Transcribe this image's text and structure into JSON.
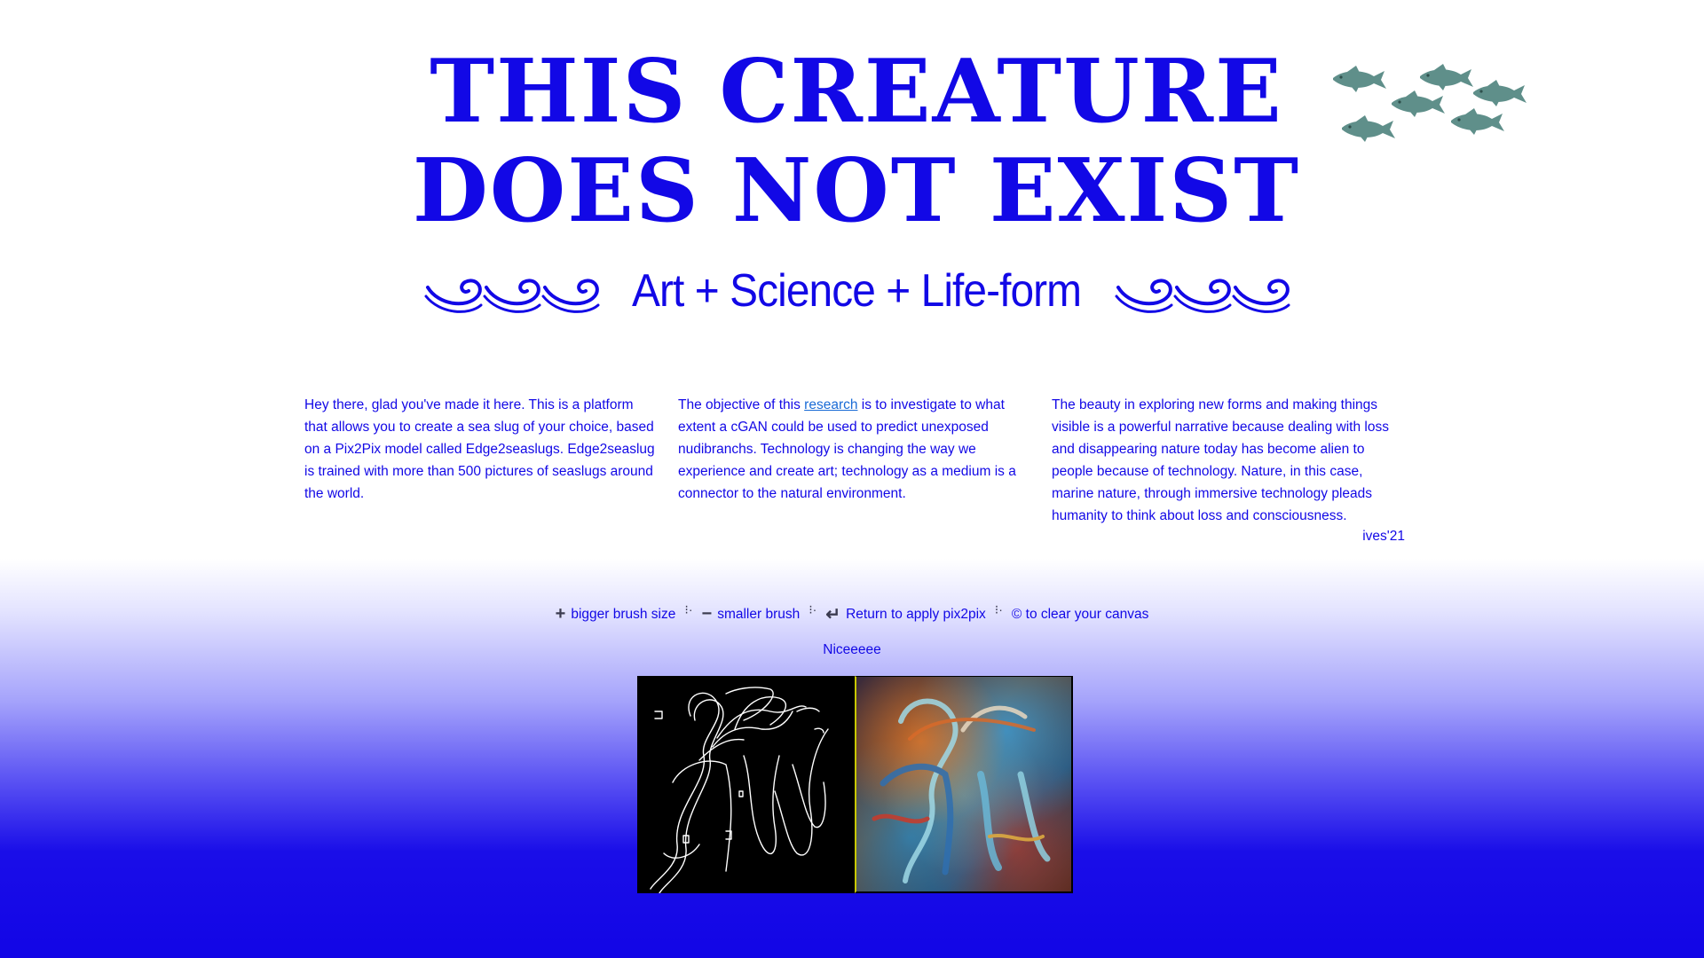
{
  "header": {
    "title_line1": "THIS CREATURE",
    "title_line2": "DOES NOT EXIST",
    "subtitle": "Art + Science + Life-form",
    "decorations": [
      "fish-school-icon",
      "wave-swirl-icon"
    ]
  },
  "intro": {
    "col1": "Hey there, glad you've made it here. This is a platform that allows you to create a sea slug of your choice, based on a Pix2Pix model called Edge2seaslugs. Edge2seaslug is trained with more than 500 pictures of seaslugs around the world.",
    "col2_before": "The objective of this ",
    "col2_link": "research",
    "col2_after": " is to investigate to what extent a cGAN could be used to predict unexposed nudibranchs. Technology is changing the way we experience and create art; technology as a medium is a connector to the natural environment.",
    "col3": "The beauty in exploring new forms and making things visible is a powerful narrative because dealing with loss and disappearing nature today has become alien to people because of technology. Nature, in this case, marine nature, through immersive technology pleads humanity to think about loss and consciousness.",
    "signature": "ives'21"
  },
  "controls": {
    "plus_symbol": "+",
    "bigger": "bigger brush size",
    "separator": "⁝·",
    "minus_symbol": "−",
    "smaller": "smaller brush",
    "return_symbol": "↵",
    "apply": "Return to apply pix2pix",
    "clear": "© to clear your canvas",
    "status": "Niceeeee"
  },
  "colors": {
    "text": "#1208e6",
    "fish": "#5f8f8a",
    "link": "#1a6bd6",
    "drawing_bg": "#000000",
    "stroke": "#ffffff"
  }
}
